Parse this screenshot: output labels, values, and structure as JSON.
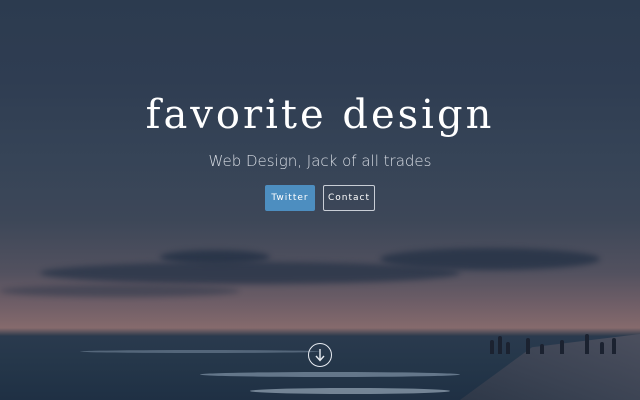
{
  "hero": {
    "title": "favorite design",
    "tagline": "Web Design, Jack of all trades"
  },
  "buttons": {
    "twitter_label": "Twitter",
    "contact_label": "Contact"
  },
  "icons": {
    "scroll_down": "arrow-down-circle-icon"
  },
  "colors": {
    "twitter_button": "#4d8ec0",
    "title_text": "#ffffff"
  }
}
